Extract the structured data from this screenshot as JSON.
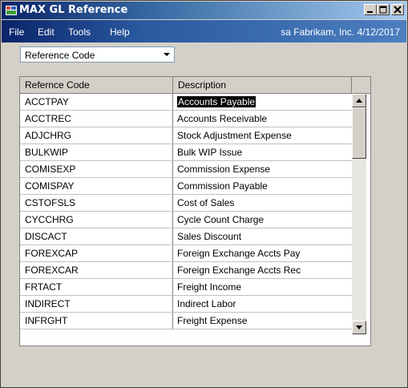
{
  "window": {
    "title": "MAX GL Reference",
    "controls": {
      "minimize": "minimize-icon",
      "maximize": "maximize-icon",
      "close": "close-icon"
    }
  },
  "menu": {
    "items": [
      "File",
      "Edit",
      "Tools",
      "Help"
    ],
    "user": "sa",
    "company": "Fabrikam, Inc.",
    "date": "4/12/2017"
  },
  "filter": {
    "selected": "Reference Code"
  },
  "grid": {
    "columns": [
      "Refernce Code",
      "Description"
    ],
    "selected_row": 0,
    "rows": [
      {
        "code": "ACCTPAY",
        "description": "Accounts Payable"
      },
      {
        "code": "ACCTREC",
        "description": "Accounts Receivable"
      },
      {
        "code": "ADJCHRG",
        "description": "Stock Adjustment Expense"
      },
      {
        "code": "BULKWIP",
        "description": "Bulk WIP Issue"
      },
      {
        "code": "COMISEXP",
        "description": "Commission Expense"
      },
      {
        "code": "COMISPAY",
        "description": "Commission Payable"
      },
      {
        "code": "CSTOFSLS",
        "description": "Cost of Sales"
      },
      {
        "code": "CYCCHRG",
        "description": "Cycle Count Charge"
      },
      {
        "code": "DISCACT",
        "description": "Sales Discount"
      },
      {
        "code": "FOREXCAP",
        "description": "Foreign Exchange Accts Pay"
      },
      {
        "code": "FOREXCAR",
        "description": "Foreign Exchange Accts Rec"
      },
      {
        "code": "FRTACT",
        "description": "Freight Income"
      },
      {
        "code": "INDIRECT",
        "description": "Indirect Labor"
      },
      {
        "code": "INFRGHT",
        "description": "Freight Expense"
      }
    ]
  }
}
